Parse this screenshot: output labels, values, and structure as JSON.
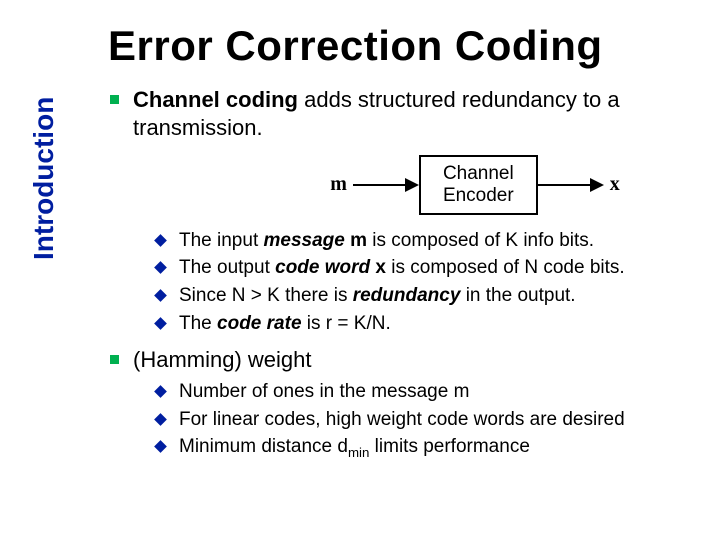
{
  "title": "Error Correction Coding",
  "sidebar_label": "Introduction",
  "bullets": {
    "b1_lead": "Channel coding",
    "b1_rest": " adds structured redundancy to a transmission.",
    "b2": "(Hamming) weight"
  },
  "diagram": {
    "in_label": "m",
    "out_label": "x",
    "box_line1": "Channel",
    "box_line2": "Encoder"
  },
  "sub1": {
    "s1_a": "The input ",
    "s1_b": "message",
    "s1_c": " ",
    "s1_d": "m",
    "s1_e": " is composed of K info bits.",
    "s2_a": "The output ",
    "s2_b": "code word",
    "s2_c": " ",
    "s2_d": "x",
    "s2_e": " is composed of N code bits.",
    "s3_a": "Since N > K there is ",
    "s3_b": "redundancy",
    "s3_c": " in the output.",
    "s4_a": "The ",
    "s4_b": "code rate",
    "s4_c": " is r = K/N."
  },
  "sub2": {
    "s1": "Number of ones in the message m",
    "s2": "For linear codes, high weight code words are desired",
    "s3_a": "Minimum distance d",
    "s3_b": "min",
    "s3_c": " limits performance"
  }
}
